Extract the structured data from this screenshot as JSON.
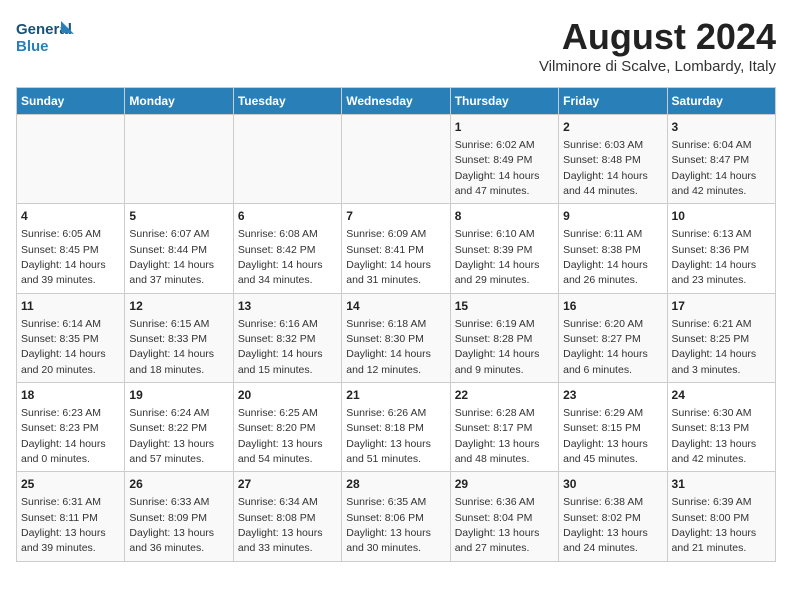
{
  "header": {
    "logo_line1": "General",
    "logo_line2": "Blue",
    "main_title": "August 2024",
    "subtitle": "Vilminore di Scalve, Lombardy, Italy"
  },
  "days_of_week": [
    "Sunday",
    "Monday",
    "Tuesday",
    "Wednesday",
    "Thursday",
    "Friday",
    "Saturday"
  ],
  "weeks": [
    [
      {
        "day": "",
        "detail": ""
      },
      {
        "day": "",
        "detail": ""
      },
      {
        "day": "",
        "detail": ""
      },
      {
        "day": "",
        "detail": ""
      },
      {
        "day": "1",
        "detail": "Sunrise: 6:02 AM\nSunset: 8:49 PM\nDaylight: 14 hours and 47 minutes."
      },
      {
        "day": "2",
        "detail": "Sunrise: 6:03 AM\nSunset: 8:48 PM\nDaylight: 14 hours and 44 minutes."
      },
      {
        "day": "3",
        "detail": "Sunrise: 6:04 AM\nSunset: 8:47 PM\nDaylight: 14 hours and 42 minutes."
      }
    ],
    [
      {
        "day": "4",
        "detail": "Sunrise: 6:05 AM\nSunset: 8:45 PM\nDaylight: 14 hours and 39 minutes."
      },
      {
        "day": "5",
        "detail": "Sunrise: 6:07 AM\nSunset: 8:44 PM\nDaylight: 14 hours and 37 minutes."
      },
      {
        "day": "6",
        "detail": "Sunrise: 6:08 AM\nSunset: 8:42 PM\nDaylight: 14 hours and 34 minutes."
      },
      {
        "day": "7",
        "detail": "Sunrise: 6:09 AM\nSunset: 8:41 PM\nDaylight: 14 hours and 31 minutes."
      },
      {
        "day": "8",
        "detail": "Sunrise: 6:10 AM\nSunset: 8:39 PM\nDaylight: 14 hours and 29 minutes."
      },
      {
        "day": "9",
        "detail": "Sunrise: 6:11 AM\nSunset: 8:38 PM\nDaylight: 14 hours and 26 minutes."
      },
      {
        "day": "10",
        "detail": "Sunrise: 6:13 AM\nSunset: 8:36 PM\nDaylight: 14 hours and 23 minutes."
      }
    ],
    [
      {
        "day": "11",
        "detail": "Sunrise: 6:14 AM\nSunset: 8:35 PM\nDaylight: 14 hours and 20 minutes."
      },
      {
        "day": "12",
        "detail": "Sunrise: 6:15 AM\nSunset: 8:33 PM\nDaylight: 14 hours and 18 minutes."
      },
      {
        "day": "13",
        "detail": "Sunrise: 6:16 AM\nSunset: 8:32 PM\nDaylight: 14 hours and 15 minutes."
      },
      {
        "day": "14",
        "detail": "Sunrise: 6:18 AM\nSunset: 8:30 PM\nDaylight: 14 hours and 12 minutes."
      },
      {
        "day": "15",
        "detail": "Sunrise: 6:19 AM\nSunset: 8:28 PM\nDaylight: 14 hours and 9 minutes."
      },
      {
        "day": "16",
        "detail": "Sunrise: 6:20 AM\nSunset: 8:27 PM\nDaylight: 14 hours and 6 minutes."
      },
      {
        "day": "17",
        "detail": "Sunrise: 6:21 AM\nSunset: 8:25 PM\nDaylight: 14 hours and 3 minutes."
      }
    ],
    [
      {
        "day": "18",
        "detail": "Sunrise: 6:23 AM\nSunset: 8:23 PM\nDaylight: 14 hours and 0 minutes."
      },
      {
        "day": "19",
        "detail": "Sunrise: 6:24 AM\nSunset: 8:22 PM\nDaylight: 13 hours and 57 minutes."
      },
      {
        "day": "20",
        "detail": "Sunrise: 6:25 AM\nSunset: 8:20 PM\nDaylight: 13 hours and 54 minutes."
      },
      {
        "day": "21",
        "detail": "Sunrise: 6:26 AM\nSunset: 8:18 PM\nDaylight: 13 hours and 51 minutes."
      },
      {
        "day": "22",
        "detail": "Sunrise: 6:28 AM\nSunset: 8:17 PM\nDaylight: 13 hours and 48 minutes."
      },
      {
        "day": "23",
        "detail": "Sunrise: 6:29 AM\nSunset: 8:15 PM\nDaylight: 13 hours and 45 minutes."
      },
      {
        "day": "24",
        "detail": "Sunrise: 6:30 AM\nSunset: 8:13 PM\nDaylight: 13 hours and 42 minutes."
      }
    ],
    [
      {
        "day": "25",
        "detail": "Sunrise: 6:31 AM\nSunset: 8:11 PM\nDaylight: 13 hours and 39 minutes."
      },
      {
        "day": "26",
        "detail": "Sunrise: 6:33 AM\nSunset: 8:09 PM\nDaylight: 13 hours and 36 minutes."
      },
      {
        "day": "27",
        "detail": "Sunrise: 6:34 AM\nSunset: 8:08 PM\nDaylight: 13 hours and 33 minutes."
      },
      {
        "day": "28",
        "detail": "Sunrise: 6:35 AM\nSunset: 8:06 PM\nDaylight: 13 hours and 30 minutes."
      },
      {
        "day": "29",
        "detail": "Sunrise: 6:36 AM\nSunset: 8:04 PM\nDaylight: 13 hours and 27 minutes."
      },
      {
        "day": "30",
        "detail": "Sunrise: 6:38 AM\nSunset: 8:02 PM\nDaylight: 13 hours and 24 minutes."
      },
      {
        "day": "31",
        "detail": "Sunrise: 6:39 AM\nSunset: 8:00 PM\nDaylight: 13 hours and 21 minutes."
      }
    ]
  ]
}
